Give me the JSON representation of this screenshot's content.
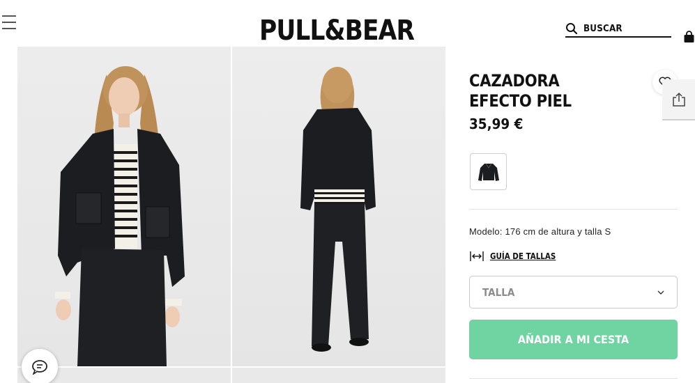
{
  "header": {
    "brand": "PULL&BEAR",
    "search_label": "BUSCAR"
  },
  "product": {
    "title": "CAZADORA EFECTO PIEL",
    "price": "35,99 €",
    "model_info": "Modelo: 176 cm de altura y talla S",
    "size_guide_label": "GUÍA DE TALLAS",
    "size_select_label": "TALLA",
    "add_to_cart_label": "AÑADIR A MI CESTA"
  },
  "colors": {
    "accent": "#6fd3a2",
    "text": "#111111",
    "jacket": "#1c1d20"
  },
  "icons": {
    "menu": "hamburger-icon",
    "search": "search-icon",
    "bag": "shopping-bag-icon",
    "favorite": "heart-icon",
    "share": "share-icon",
    "size_guide": "ruler-arrows-icon",
    "dropdown": "chevron-down-icon",
    "chat": "chat-bubble-icon"
  }
}
